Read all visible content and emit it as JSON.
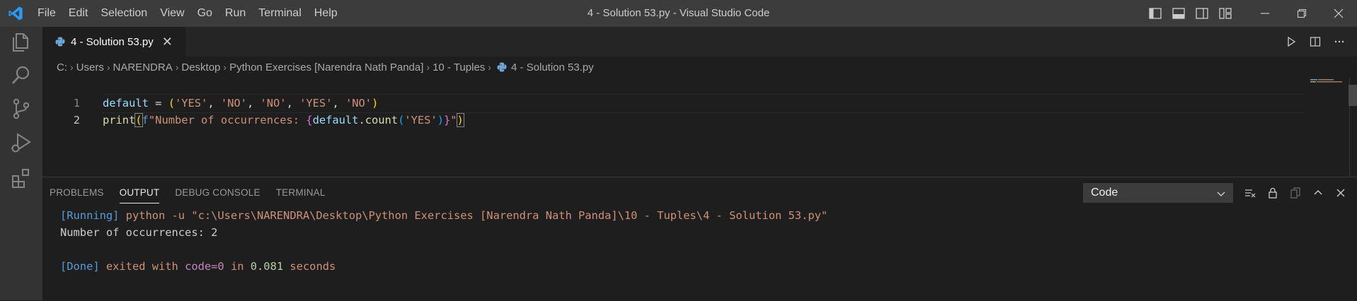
{
  "window": {
    "title": "4 - Solution 53.py - Visual Studio Code"
  },
  "menu": [
    "File",
    "Edit",
    "Selection",
    "View",
    "Go",
    "Run",
    "Terminal",
    "Help"
  ],
  "tab": {
    "label": "4 - Solution 53.py",
    "close": "✕"
  },
  "breadcrumb": {
    "parts": [
      "C:",
      "Users",
      "NARENDRA",
      "Desktop",
      "Python Exercises [Narendra Nath Panda]",
      "10 - Tuples"
    ],
    "file": "4 - Solution 53.py"
  },
  "code": {
    "line_numbers": [
      "1",
      "2"
    ],
    "line1": {
      "var": "default",
      "eq": " = ",
      "open": "(",
      "s1": "'YES'",
      "c1": ", ",
      "s2": "'NO'",
      "c2": ", ",
      "s3": "'NO'",
      "c3": ", ",
      "s4": "'YES'",
      "c4": ", ",
      "s5": "'NO'",
      "close": ")"
    },
    "line2": {
      "fn": "print",
      "open": "(",
      "fprefix": "f",
      "str_a": "\"Number of occurrences: ",
      "brace_open": "{",
      "expr_var": "default",
      "dot": ".",
      "method": "count",
      "p_open": "(",
      "arg": "'YES'",
      "p_close": ")",
      "brace_close": "}",
      "str_b": "\"",
      "close": ")"
    }
  },
  "panel": {
    "tabs": [
      "PROBLEMS",
      "OUTPUT",
      "DEBUG CONSOLE",
      "TERMINAL"
    ],
    "active_tab": "OUTPUT",
    "channel": "Code",
    "output": {
      "running_tag": "[Running]",
      "command": " python -u \"c:\\Users\\NARENDRA\\Desktop\\Python Exercises [Narendra Nath Panda]\\10 - Tuples\\4 - Solution 53.py\"",
      "result": "Number of occurrences: 2",
      "done_tag": "[Done]",
      "exited": " exited with ",
      "code_eq": "code=0",
      "in": " in ",
      "time": "0.081",
      "seconds": " seconds"
    }
  },
  "colors": {
    "accent": "#007acc",
    "titlebar": "#3c3c3c",
    "activitybar": "#333333",
    "editor_bg": "#1e1e1e"
  },
  "icons": {
    "activity": [
      "explorer-icon",
      "search-icon",
      "source-control-icon",
      "run-debug-icon",
      "extensions-icon"
    ],
    "title": [
      "toggle-primary-sidebar-icon",
      "toggle-panel-icon",
      "toggle-secondary-sidebar-icon",
      "customize-layout-icon",
      "minimize-icon",
      "restore-icon",
      "close-icon"
    ],
    "editor": [
      "run-icon",
      "split-editor-icon",
      "more-actions-icon"
    ],
    "panel": [
      "clear-output-icon",
      "lock-icon",
      "copy-icon",
      "maximize-panel-icon",
      "close-panel-icon"
    ]
  }
}
